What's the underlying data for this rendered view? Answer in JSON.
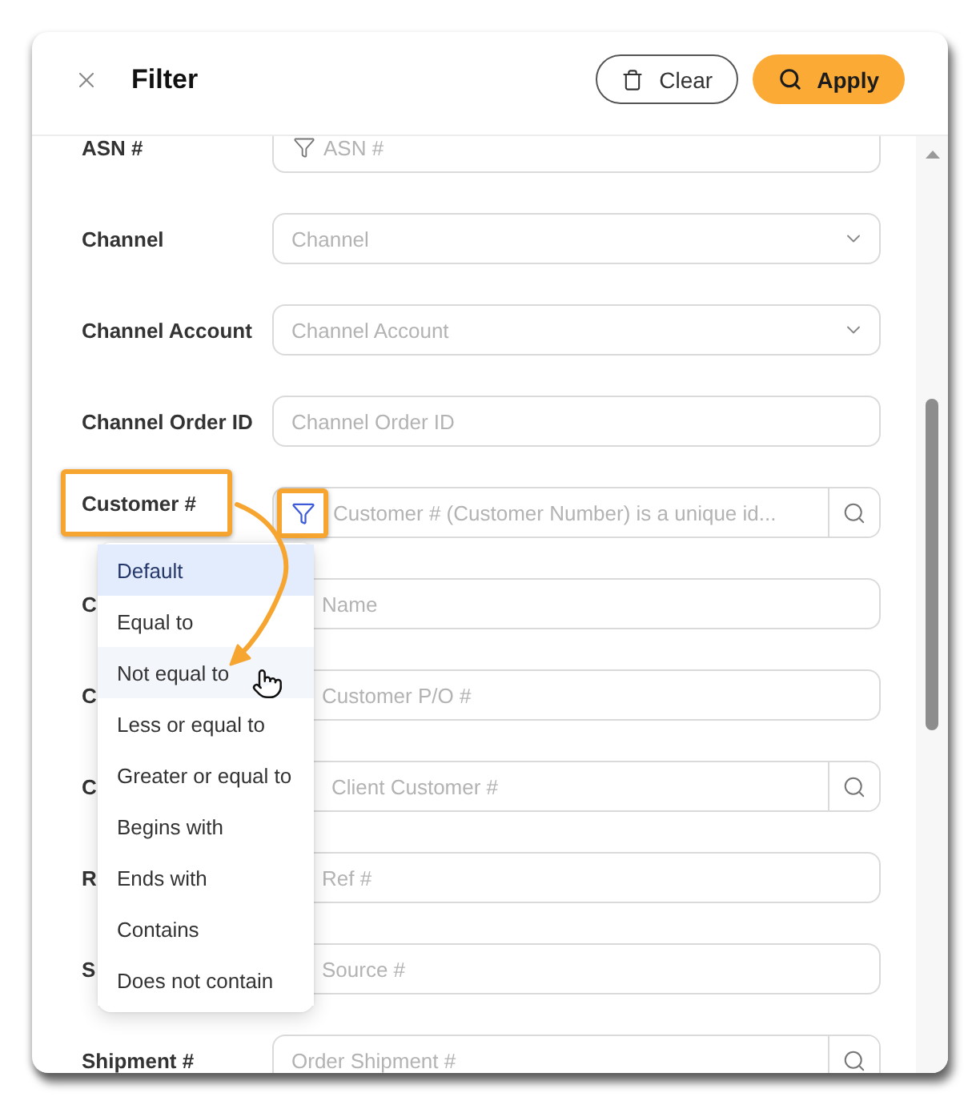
{
  "header": {
    "title": "Filter",
    "buttons": [
      {
        "label": "Clear",
        "kind": "clear"
      },
      {
        "label": "Apply",
        "kind": "apply"
      }
    ]
  },
  "fields": [
    {
      "label": "ASN #",
      "kind": "filter",
      "placeholder": "ASN #",
      "highlighted": false
    },
    {
      "label": "Channel",
      "kind": "select",
      "placeholder": "Channel",
      "highlighted": false
    },
    {
      "label": "Channel Account",
      "kind": "select",
      "placeholder": "Channel Account",
      "highlighted": false
    },
    {
      "label": "Channel Order ID",
      "kind": "text",
      "placeholder": "Channel Order ID",
      "highlighted": false
    },
    {
      "label": "Customer #",
      "kind": "filter_search",
      "placeholder": "Customer # (Customer Number) is a unique id...",
      "highlighted": true
    },
    {
      "label": "C",
      "kind": "filter",
      "placeholder": "Name",
      "highlighted": false
    },
    {
      "label": "C",
      "kind": "filter",
      "placeholder": "Customer P/O #",
      "highlighted": false
    },
    {
      "label": "C",
      "kind": "filter_search",
      "placeholder": "Client Customer #",
      "highlighted": false
    },
    {
      "label": "R",
      "kind": "filter",
      "placeholder": "Ref #",
      "highlighted": false
    },
    {
      "label": "S",
      "kind": "filter",
      "placeholder": "Source #",
      "highlighted": false
    },
    {
      "label": "Shipment #",
      "kind": "search",
      "placeholder": "Order Shipment #",
      "highlighted": false
    }
  ],
  "operator_menu": {
    "items": [
      {
        "label": "Default",
        "selected": true,
        "hovered": false
      },
      {
        "label": "Equal to",
        "selected": false,
        "hovered": false
      },
      {
        "label": "Not equal to",
        "selected": false,
        "hovered": true
      },
      {
        "label": "Less or equal to",
        "selected": false,
        "hovered": false
      },
      {
        "label": "Greater or equal to",
        "selected": false,
        "hovered": false
      },
      {
        "label": "Begins with",
        "selected": false,
        "hovered": false
      },
      {
        "label": "Ends with",
        "selected": false,
        "hovered": false
      },
      {
        "label": "Contains",
        "selected": false,
        "hovered": false
      },
      {
        "label": "Does not contain",
        "selected": false,
        "hovered": false
      }
    ]
  }
}
